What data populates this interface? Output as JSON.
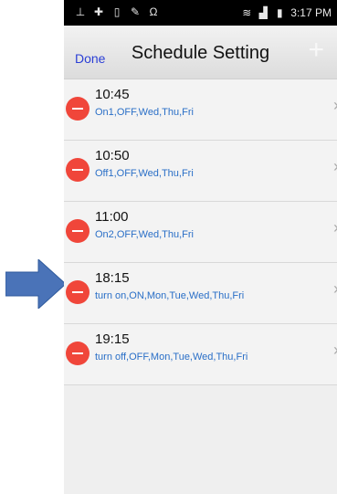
{
  "status_bar": {
    "time": "3:17 PM"
  },
  "header": {
    "done_label": "Done",
    "title": "Schedule Setting",
    "add_label": "+"
  },
  "schedules": [
    {
      "time": "10:45",
      "desc": "On1,OFF,Wed,Thu,Fri"
    },
    {
      "time": "10:50",
      "desc": "Off1,OFF,Wed,Thu,Fri"
    },
    {
      "time": "11:00",
      "desc": "On2,OFF,Wed,Thu,Fri"
    },
    {
      "time": "18:15",
      "desc": "turn on,ON,Mon,Tue,Wed,Thu,Fri"
    },
    {
      "time": "19:15",
      "desc": "turn off,OFF,Mon,Tue,Wed,Thu,Fri"
    }
  ],
  "colors": {
    "accent": "#2b3fd6",
    "delete": "#f0463a",
    "desc_text": "#2a6fc7",
    "arrow": "#4a73b8"
  },
  "icons": [
    "usb-icon",
    "add-icon",
    "sim-icon",
    "edit-icon",
    "headset-icon",
    "wifi-icon",
    "signal-icon",
    "battery-icon",
    "chevron-right-icon",
    "delete-icon",
    "arrow-annotation-icon"
  ]
}
